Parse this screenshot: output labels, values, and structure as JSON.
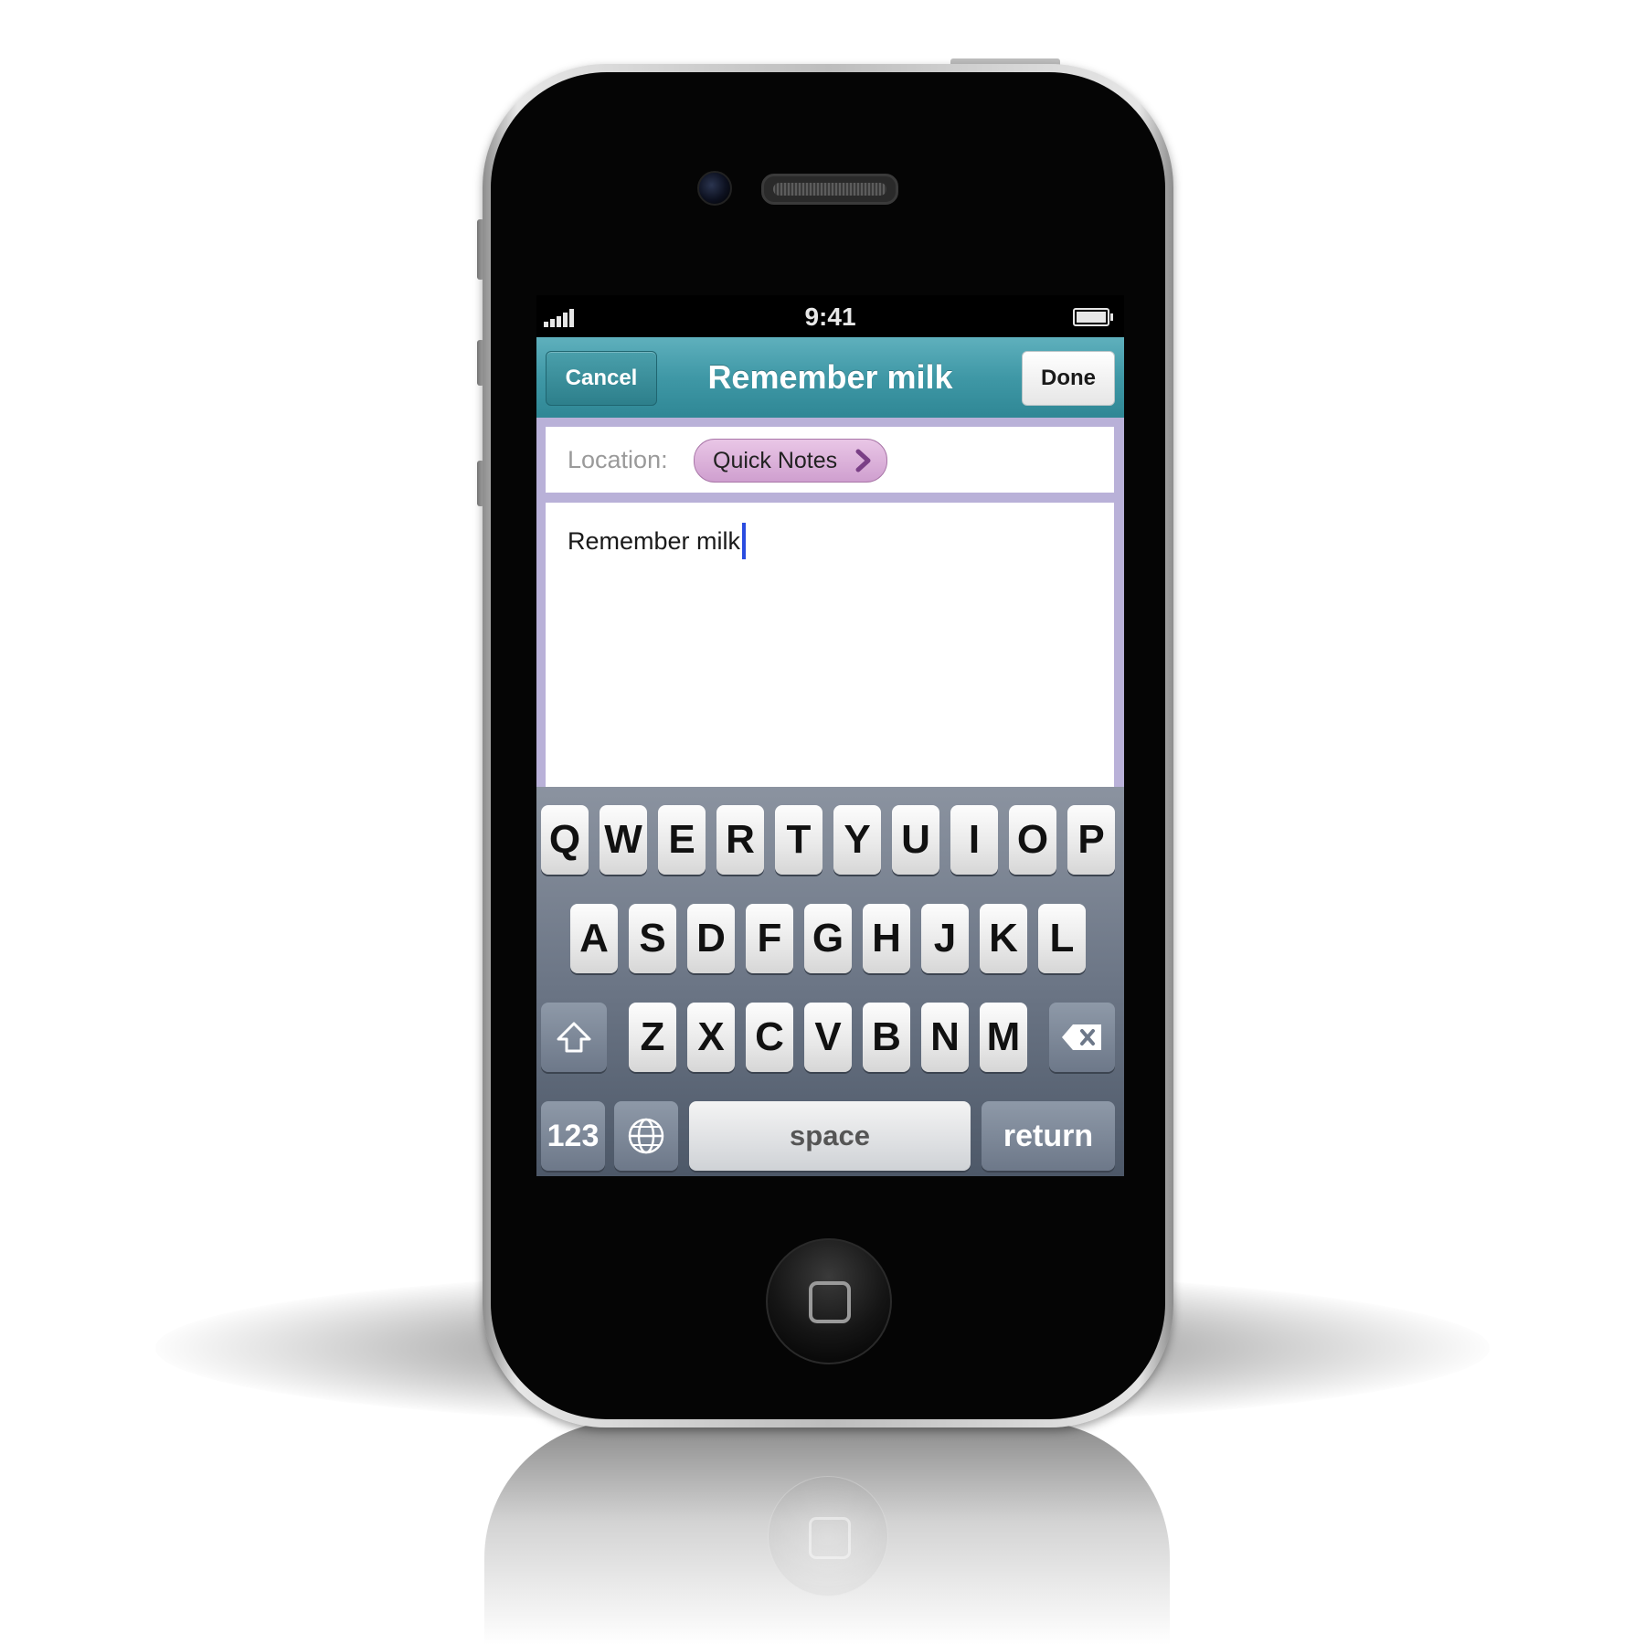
{
  "status_bar": {
    "time": "9:41"
  },
  "nav_bar": {
    "cancel_label": "Cancel",
    "title": "Remember milk",
    "done_label": "Done"
  },
  "location": {
    "label": "Location:",
    "value": "Quick Notes"
  },
  "note": {
    "text": "Remember milk"
  },
  "keyboard": {
    "row1": [
      "Q",
      "W",
      "E",
      "R",
      "T",
      "Y",
      "U",
      "I",
      "O",
      "P"
    ],
    "row2": [
      "A",
      "S",
      "D",
      "F",
      "G",
      "H",
      "J",
      "K",
      "L"
    ],
    "row3": [
      "Z",
      "X",
      "C",
      "V",
      "B",
      "N",
      "M"
    ],
    "numbers_label": "123",
    "space_label": "space",
    "return_label": "return"
  },
  "colors": {
    "nav_bar": "#3f98a6",
    "location_chip": "#d9acd8",
    "content_background": "#b9b1d8",
    "caret": "#2a4ce0"
  }
}
